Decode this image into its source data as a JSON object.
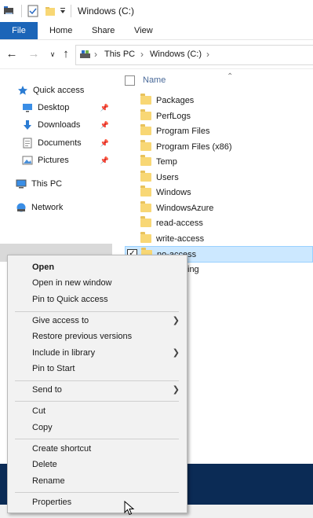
{
  "window": {
    "title": "Windows (C:)"
  },
  "ribbon": {
    "tabs": [
      "File",
      "Home",
      "Share",
      "View"
    ]
  },
  "address": {
    "crumbs": [
      "This PC",
      "Windows (C:)"
    ]
  },
  "nav": {
    "quick_access": "Quick access",
    "items": [
      {
        "label": "Desktop",
        "icon": "desktop-icon"
      },
      {
        "label": "Downloads",
        "icon": "downloads-icon"
      },
      {
        "label": "Documents",
        "icon": "documents-icon"
      },
      {
        "label": "Pictures",
        "icon": "pictures-icon"
      }
    ],
    "this_pc": "This PC",
    "network": "Network"
  },
  "content": {
    "column_name": "Name",
    "folders": [
      "Packages",
      "PerfLogs",
      "Program Files",
      "Program Files (x86)",
      "Temp",
      "Users",
      "Windows",
      "WindowsAzure",
      "read-access",
      "write-access",
      "no-access"
    ],
    "partial_item": "ing"
  },
  "context_menu": {
    "items": [
      "Open",
      "Open in new window",
      "Pin to Quick access",
      "Give access to",
      "Restore previous versions",
      "Include in library",
      "Pin to Start",
      "Send to",
      "Cut",
      "Copy",
      "Create shortcut",
      "Delete",
      "Rename",
      "Properties"
    ]
  },
  "colors": {
    "accent": "#1b65b8",
    "selection": "#cce8ff",
    "folder": "#f8d775",
    "taskbar": "#0b2b55"
  }
}
